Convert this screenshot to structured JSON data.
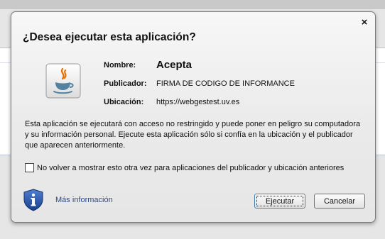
{
  "dialog": {
    "title": "¿Desea ejecutar esta aplicación?",
    "close_glyph": "×"
  },
  "app_info": {
    "name_label": "Nombre:",
    "name_value": "Acepta",
    "publisher_label": "Publicador:",
    "publisher_value": "FIRMA DE CODIGO DE INFORMANCE",
    "location_label": "Ubicación:",
    "location_value": "https://webgestest.uv.es"
  },
  "description": "Esta aplicación se ejecutará con acceso no restringido y puede poner en peligro su computadora y su información personal. Ejecute esta aplicación sólo si confía en la ubicación y el publicador que aparecen anteriormente.",
  "checkbox": {
    "label": "No volver a mostrar esto otra vez para aplicaciones del publicador y ubicación anteriores",
    "checked": false
  },
  "footer": {
    "more_info": "Más información",
    "run_button": "Ejecutar",
    "cancel_button": "Cancelar"
  },
  "icons": {
    "app": "java-icon",
    "info": "shield-info-icon"
  },
  "colors": {
    "link": "#2a4a8a",
    "shield": "#1f4e9c",
    "java_orange": "#e76f00",
    "java_blue": "#5382a1"
  }
}
